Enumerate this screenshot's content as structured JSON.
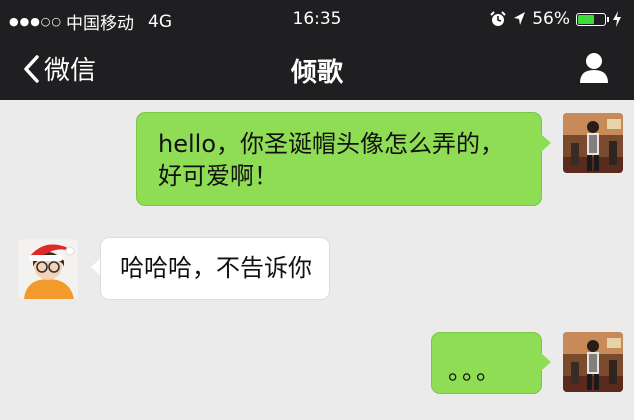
{
  "status": {
    "carrier": "中国移动",
    "network": "4G",
    "time": "16:35",
    "battery": "56%",
    "battery_level": 0.56
  },
  "nav": {
    "back_label": "微信",
    "title": "倾歌"
  },
  "messages": [
    {
      "from": "me",
      "text_line1": "hello，你圣诞帽头像怎么弄的，",
      "text_line2": "好可爱啊！"
    },
    {
      "from": "friend",
      "text": "哈哈哈，不告诉你"
    },
    {
      "from": "me",
      "text": "。。。"
    }
  ],
  "colors": {
    "bubble_out": "#8edd54",
    "bubble_in": "#ffffff",
    "background": "#ebebeb",
    "topbar": "#1f1f21",
    "battery": "#3ddc3b"
  }
}
